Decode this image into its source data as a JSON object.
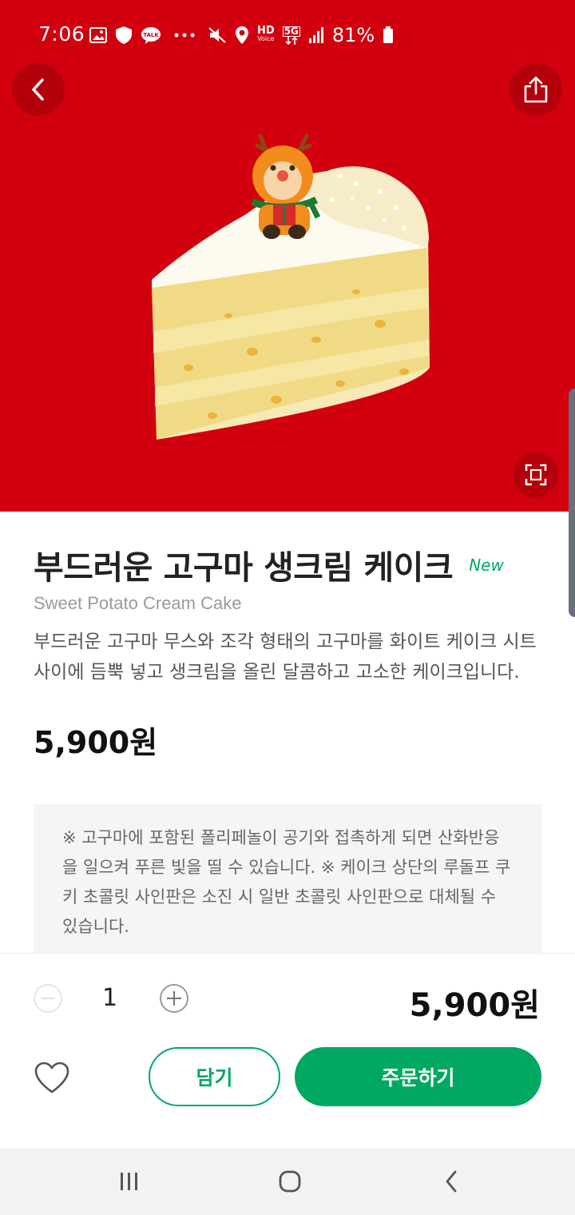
{
  "status_bar": {
    "time": "7:06",
    "battery_percent": "81%",
    "icons": [
      "gallery-icon",
      "shield-icon",
      "talk-icon",
      "more-icon",
      "mute-icon",
      "location-icon",
      "hd-voice-icon",
      "5g-icon",
      "signal-icon",
      "battery-icon"
    ],
    "hd_label": "HD",
    "voice_label": "Voice",
    "net_label": "5G"
  },
  "header": {
    "back_icon": "chevron-left-icon",
    "share_icon": "share-icon",
    "zoom_icon": "fullscreen-icon",
    "background_color": "#d2000f"
  },
  "product": {
    "title": "부드러운 고구마 생크림 케이크",
    "badge": "New",
    "subtitle": "Sweet Potato Cream Cake",
    "description": "부드러운 고구마 무스와 조각 형태의 고구마를 화이트 케이크 시트 사이에 듬뿍 넣고 생크림을 올린 달콤하고 고소한 케이크입니다.",
    "price": "5,900원",
    "notice": "※ 고구마에 포함된 폴리페놀이 공기와 접촉하게 되면 산화반응을 일으켜 푸른 빛을 띨 수 있습니다. ※ 케이크 상단의 루돌프 쿠키 초콜릿 사인판은 소진 시 일반 초콜릿 사인판으로 대체될 수 있습니다."
  },
  "order_bar": {
    "quantity": "1",
    "total": "5,900원",
    "cart_label": "담기",
    "order_label": "주문하기",
    "accent_color": "#00a862"
  },
  "nav_bar": {
    "items": [
      "recent-apps-icon",
      "home-icon",
      "back-icon"
    ]
  }
}
